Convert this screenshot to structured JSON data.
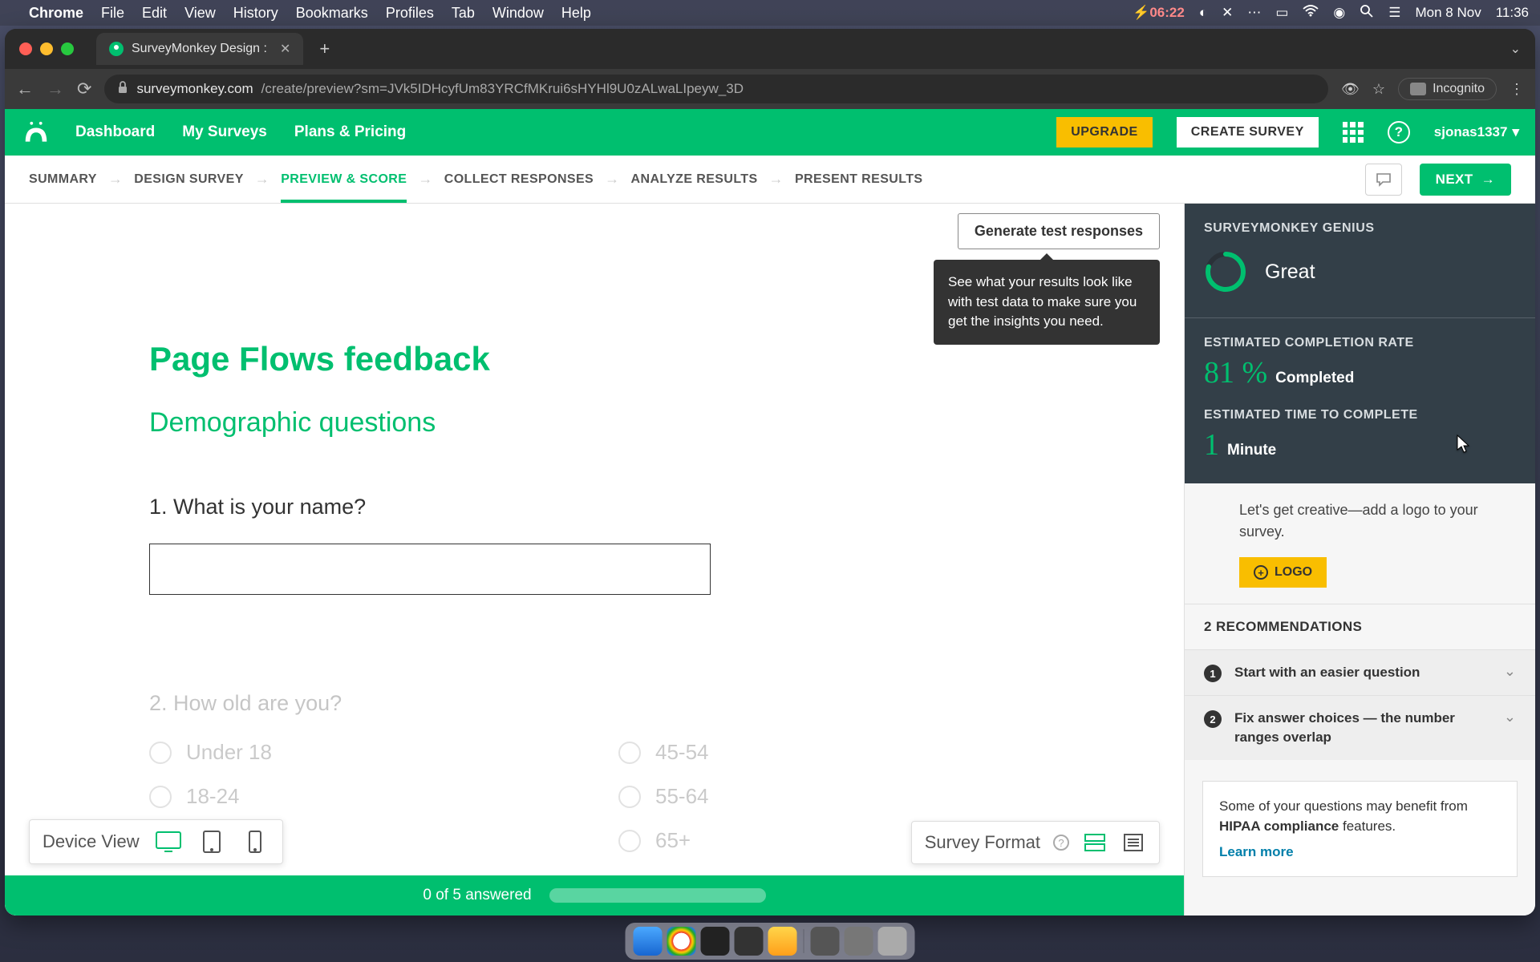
{
  "mac_menu": {
    "app": "Chrome",
    "items": [
      "File",
      "Edit",
      "View",
      "History",
      "Bookmarks",
      "Profiles",
      "Tab",
      "Window",
      "Help"
    ],
    "battery_time": "06:22",
    "date": "Mon 8 Nov",
    "time": "11:36"
  },
  "chrome": {
    "tab_title": "SurveyMonkey Design :",
    "url_domain": "surveymonkey.com",
    "url_path": "/create/preview?sm=JVk5IDHcyfUm83YRCfMKrui6sHYHl9U0zALwaLIpeyw_3D",
    "incognito": "Incognito"
  },
  "sm_nav": {
    "links": [
      "Dashboard",
      "My Surveys",
      "Plans & Pricing"
    ],
    "upgrade": "UPGRADE",
    "create": "CREATE SURVEY",
    "user": "sjonas1337"
  },
  "steps": {
    "items": [
      "SUMMARY",
      "DESIGN SURVEY",
      "PREVIEW & SCORE",
      "COLLECT RESPONSES",
      "ANALYZE RESULTS",
      "PRESENT RESULTS"
    ],
    "active_index": 2,
    "next": "NEXT"
  },
  "survey": {
    "gen_test": "Generate test responses",
    "gen_tooltip": "See what your results look like with test data to make sure you get the insights you need.",
    "title": "Page Flows feedback",
    "subtitle": "Demographic questions",
    "q1_label": "1. What is your name?",
    "q2_label": "2. How old are you?",
    "q2_options_left": [
      "Under 18",
      "18-24"
    ],
    "q2_options_right": [
      "45-54",
      "55-64",
      "65+"
    ],
    "progress": "0 of 5 answered"
  },
  "device_view": {
    "label": "Device View"
  },
  "survey_format": {
    "label": "Survey Format"
  },
  "genius": {
    "title": "SURVEYMONKEY GENIUS",
    "score": "Great",
    "completion_head": "ESTIMATED COMPLETION RATE",
    "completion_val": "81 %",
    "completion_unit": "Completed",
    "time_head": "ESTIMATED TIME TO COMPLETE",
    "time_val": "1",
    "time_unit": "Minute",
    "logo_tip": "Let's get creative—add a logo to your survey.",
    "logo_btn": "LOGO",
    "recs_head": "2 RECOMMENDATIONS",
    "rec1": "Start with an easier question",
    "rec2": "Fix answer choices — the number ranges overlap",
    "hipaa_text": "Some of your questions may benefit from ",
    "hipaa_bold": "HIPAA compliance",
    "hipaa_text2": " features.",
    "hipaa_link": "Learn more"
  }
}
